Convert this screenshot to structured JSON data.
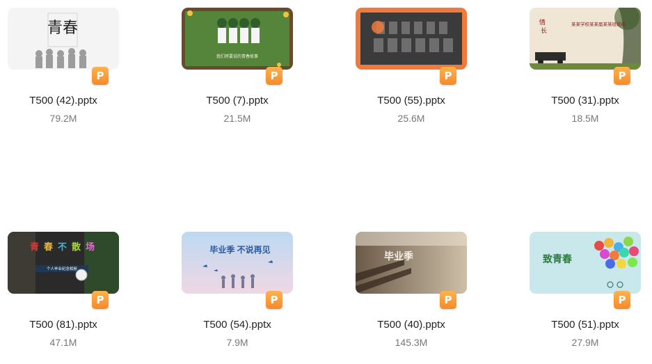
{
  "files": [
    {
      "name": "T500 (42).pptx",
      "size": "79.2M",
      "thumb_text": "青春",
      "badge": "P",
      "accent": "#f2f2f2"
    },
    {
      "name": "T500 (7).pptx",
      "size": "21.5M",
      "thumb_text": "我们将要说的青春故事",
      "badge": "P",
      "accent": "#4f7a35"
    },
    {
      "name": "T500 (55).pptx",
      "size": "25.6M",
      "thumb_text": "",
      "badge": "P",
      "accent": "#f07a3c"
    },
    {
      "name": "T500 (31).pptx",
      "size": "18.5M",
      "thumb_text": "某某学校某某届某某班班级",
      "badge": "P",
      "accent": "#efe6d6"
    },
    {
      "name": "T500 (81).pptx",
      "size": "47.1M",
      "thumb_text": "个人毕业纪念相册",
      "badge": "P",
      "accent": "#2a2a2a"
    },
    {
      "name": "T500 (54).pptx",
      "size": "7.9M",
      "thumb_text": "毕业季 不说再见",
      "badge": "P",
      "accent": "#cfe3f4"
    },
    {
      "name": "T500 (40).pptx",
      "size": "145.3M",
      "thumb_text": "毕业季",
      "badge": "P",
      "accent": "#7a6650"
    },
    {
      "name": "T500 (51).pptx",
      "size": "27.9M",
      "thumb_text": "致青春",
      "badge": "P",
      "accent": "#bfe3e9"
    }
  ]
}
